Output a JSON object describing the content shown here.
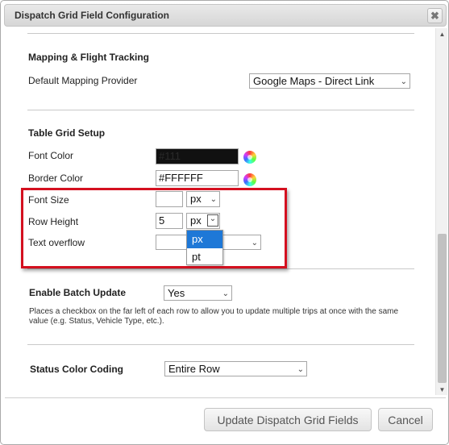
{
  "dialog": {
    "title": "Dispatch Grid Field Configuration",
    "close_label": "✖"
  },
  "mapping": {
    "section_title": "Mapping & Flight Tracking",
    "provider_label": "Default Mapping Provider",
    "provider_value": "Google Maps - Direct Link"
  },
  "table_grid": {
    "section_title": "Table Grid Setup",
    "font_color_label": "Font Color",
    "font_color_value": "#111",
    "font_color_swatch": "#111111",
    "border_color_label": "Border Color",
    "border_color_value": "#FFFFFF",
    "font_size_label": "Font Size",
    "font_size_value": "",
    "font_size_unit": "px",
    "row_height_label": "Row Height",
    "row_height_value": "5",
    "row_height_unit": "px",
    "text_overflow_label": "Text overflow",
    "text_overflow_value": "",
    "unit_options": [
      "px",
      "pt"
    ]
  },
  "batch": {
    "label": "Enable Batch Update",
    "value": "Yes",
    "help": "Places a checkbox on the far left of each row to allow you to update multiple trips at once with the same value (e.g. Status, Vehicle Type, etc.)."
  },
  "status_color": {
    "label": "Status Color Coding",
    "value": "Entire Row"
  },
  "buttons": {
    "update": "Update Dispatch Grid Fields",
    "cancel": "Cancel"
  },
  "colors": {
    "highlight": "#d4101f",
    "dropdown_selected": "#1e78d7"
  }
}
